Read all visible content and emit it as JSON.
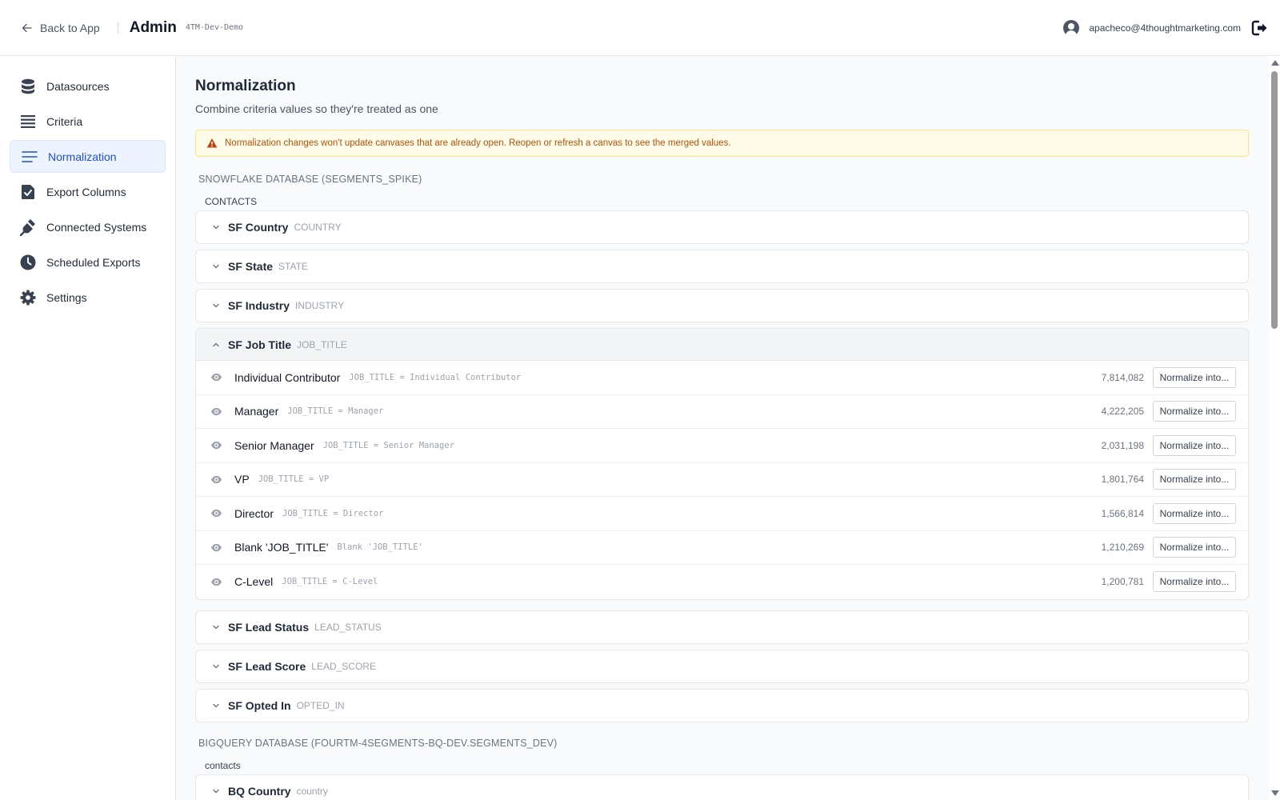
{
  "header": {
    "back_label": "Back to App",
    "title": "Admin",
    "env": "4TM-Dev-Demo",
    "user_email": "apacheco@4thoughtmarketing.com"
  },
  "sidebar": {
    "items": [
      {
        "label": "Datasources",
        "icon": "database-icon"
      },
      {
        "label": "Criteria",
        "icon": "list-icon"
      },
      {
        "label": "Normalization",
        "icon": "lines-icon",
        "active": true
      },
      {
        "label": "Export Columns",
        "icon": "checkbox-icon"
      },
      {
        "label": "Connected Systems",
        "icon": "plug-icon"
      },
      {
        "label": "Scheduled Exports",
        "icon": "clock-icon"
      },
      {
        "label": "Settings",
        "icon": "gear-icon"
      }
    ]
  },
  "page": {
    "title": "Normalization",
    "subtitle": "Combine criteria values so they're treated as one",
    "alert": "Normalization changes won't update canvases that are already open. Reopen or refresh a canvas to see the merged values."
  },
  "snowflake": {
    "header": "SNOWFLAKE DATABASE (SEGMENTS_SPIKE)",
    "table": "CONTACTS",
    "criteria": [
      {
        "label": "SF Country",
        "column": "COUNTRY"
      },
      {
        "label": "SF State",
        "column": "STATE"
      },
      {
        "label": "SF Industry",
        "column": "INDUSTRY"
      },
      {
        "label": "SF Job Title",
        "column": "JOB_TITLE"
      },
      {
        "label": "SF Lead Status",
        "column": "LEAD_STATUS"
      },
      {
        "label": "SF Lead Score",
        "column": "LEAD_SCORE"
      },
      {
        "label": "SF Opted In",
        "column": "OPTED_IN"
      }
    ],
    "job_title_values": [
      {
        "label": "Individual Contributor",
        "expr": "JOB_TITLE = Individual Contributor",
        "count": "7,814,082",
        "button": "Normalize into..."
      },
      {
        "label": "Manager",
        "expr": "JOB_TITLE = Manager",
        "count": "4,222,205",
        "button": "Normalize into..."
      },
      {
        "label": "Senior Manager",
        "expr": "JOB_TITLE = Senior Manager",
        "count": "2,031,198",
        "button": "Normalize into..."
      },
      {
        "label": "VP",
        "expr": "JOB_TITLE = VP",
        "count": "1,801,764",
        "button": "Normalize into..."
      },
      {
        "label": "Director",
        "expr": "JOB_TITLE = Director",
        "count": "1,566,814",
        "button": "Normalize into..."
      },
      {
        "label": "Blank 'JOB_TITLE'",
        "expr": "Blank 'JOB_TITLE'",
        "count": "1,210,269",
        "button": "Normalize into..."
      },
      {
        "label": "C-Level",
        "expr": "JOB_TITLE = C-Level",
        "count": "1,200,781",
        "button": "Normalize into..."
      }
    ]
  },
  "bigquery": {
    "header": "BIGQUERY DATABASE (FOURTM-4SEGMENTS-BQ-DEV.SEGMENTS_DEV)",
    "table": "contacts",
    "criteria": [
      {
        "label": "BQ Country",
        "column": "country"
      }
    ]
  }
}
